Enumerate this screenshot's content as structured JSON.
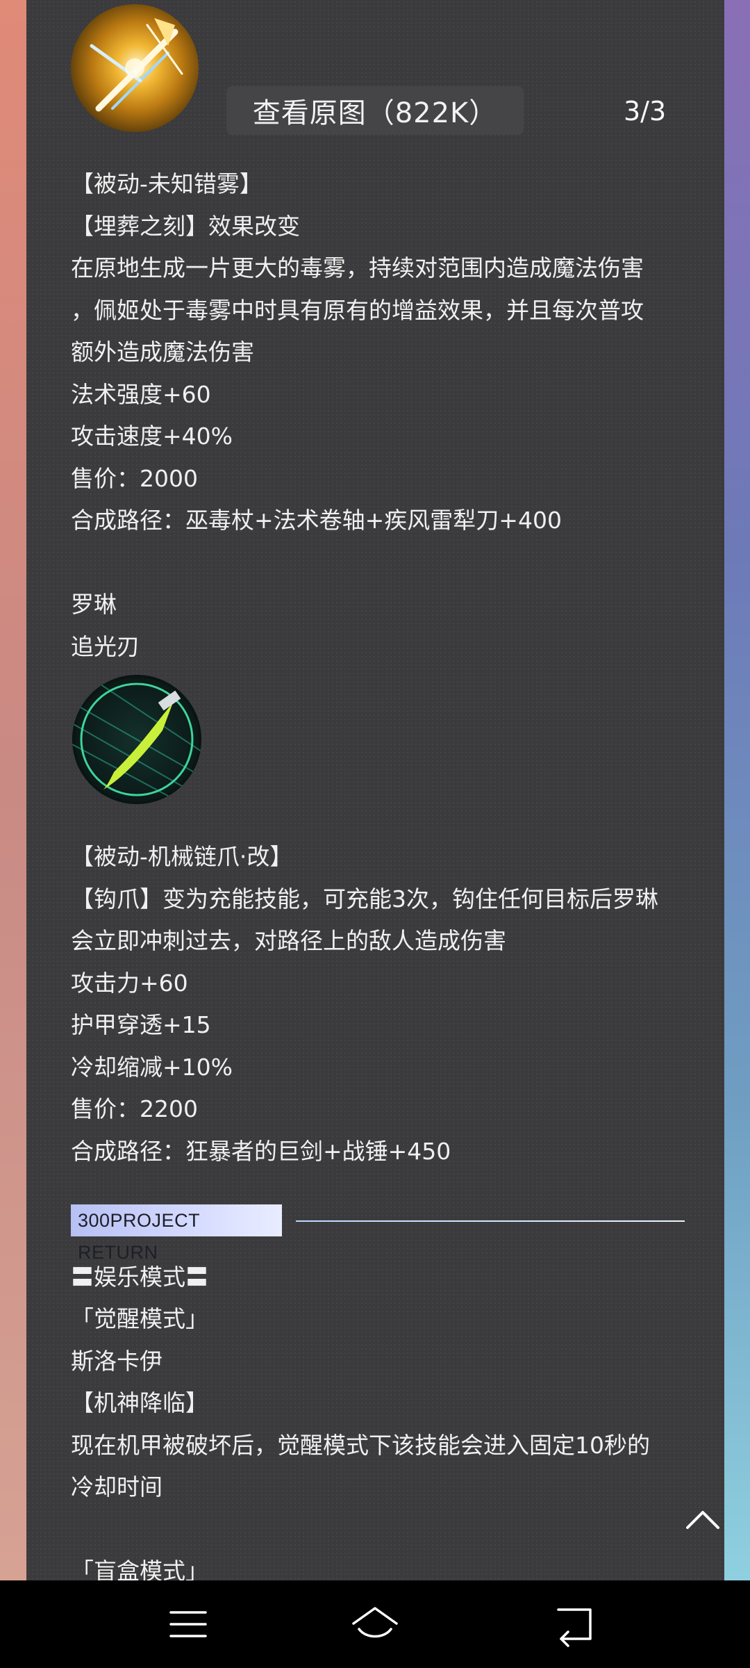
{
  "viewer": {
    "view_original_label": "查看原图（822K）",
    "page_indicator": "3/3"
  },
  "content": {
    "lines1": [
      "【被动-未知错雾】",
      "【埋葬之刻】效果改变",
      "在原地生成一片更大的毒雾，持续对范围内造成魔法伤害",
      "，佩姬处于毒雾中时具有原有的增益效果，并且每次普攻",
      "额外造成魔法伤害",
      "法术强度+60",
      "攻击速度+40%",
      "售价：2000",
      "合成路径：巫毒杖+法术卷轴+疾风雷犁刀+400"
    ],
    "hero_name": "罗琳",
    "item_name": "追光刃",
    "lines2": [
      "【被动-机械链爪·改】",
      "【钩爪】变为充能技能，可充能3次，钩住任何目标后罗琳",
      "会立即冲刺过去，对路径上的敌人造成伤害",
      "攻击力+60",
      "护甲穿透+15",
      "冷却缩减+10%",
      "售价：2200",
      "合成路径：狂暴者的巨剑+战锤+450"
    ],
    "banner_text": "300PROJECT RETURN",
    "lines3": [
      "〓娱乐模式〓",
      "「觉醒模式」",
      "斯洛卡伊",
      "【机神降临】",
      "现在机甲被破坏后，觉醒模式下该技能会进入固定10秒的",
      "冷却时间"
    ],
    "cut_line": "「盲盒模式」"
  },
  "icons": {
    "skill_icon_1": "golden-blade-skill-icon",
    "skill_icon_2": "green-light-blade-skill-icon",
    "scroll_top": "chevron-up-icon",
    "nav_menu": "menu-icon",
    "nav_home": "home-icon",
    "nav_back": "back-icon"
  },
  "colors": {
    "panel_bg": "#3b3b3d",
    "text": "#f0f0f0",
    "banner_bg": "#c9d0fb",
    "navbar_bg": "#000000"
  }
}
